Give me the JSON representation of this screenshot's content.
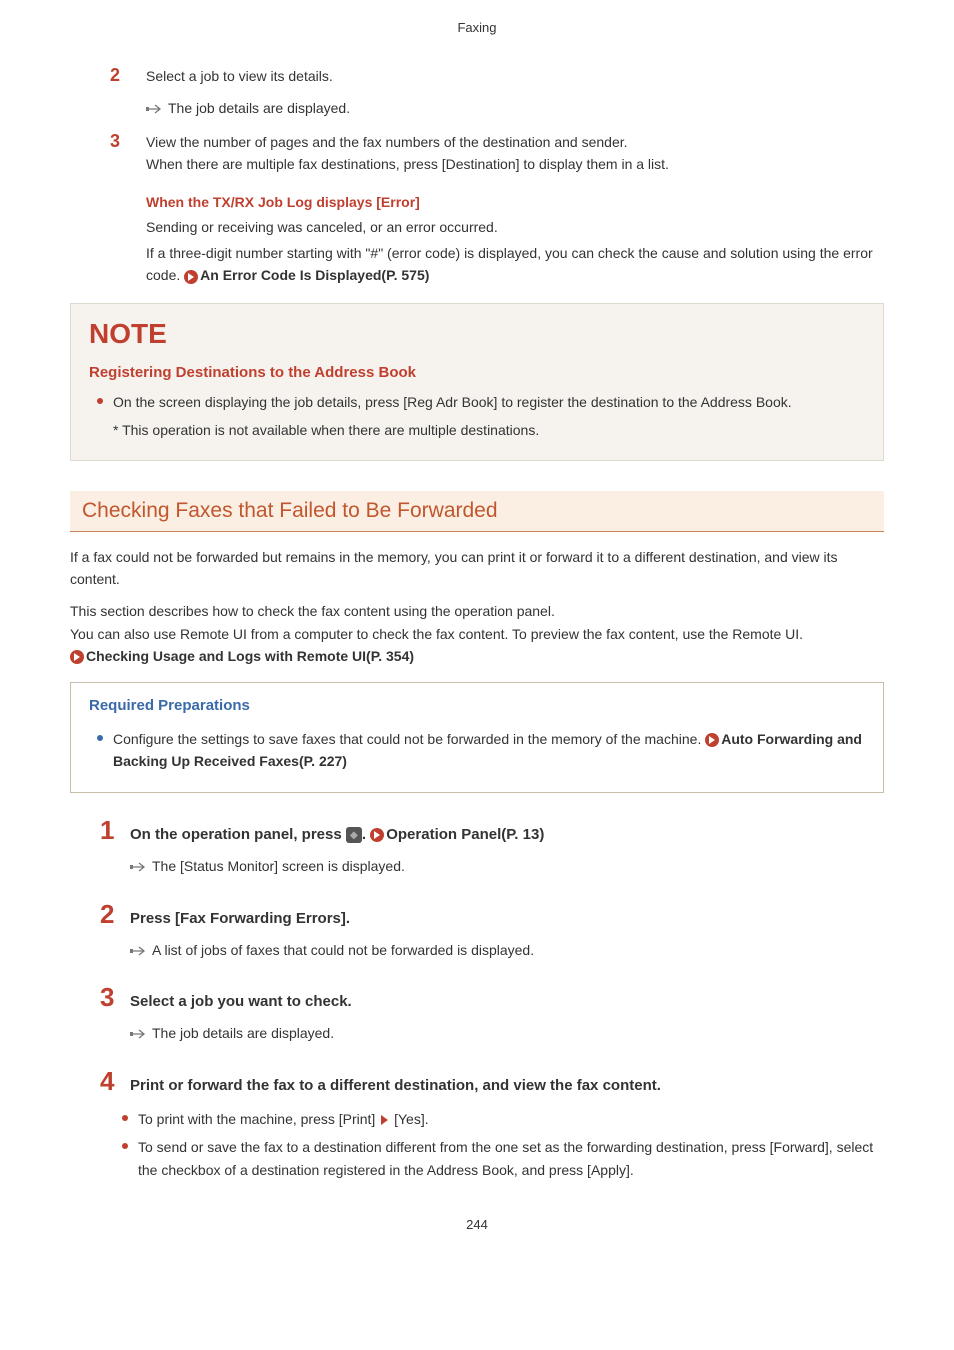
{
  "header": "Faxing",
  "topSteps": [
    {
      "num": "2",
      "text": "Select a job to view its details.",
      "result": "The job details are displayed."
    },
    {
      "num": "3",
      "line1": "View the number of pages and the fax numbers of the destination and sender.",
      "line2": "When there are multiple fax destinations, press [Destination] to display them in a list."
    }
  ],
  "errorSection": {
    "heading": "When the TX/RX Job Log displays [Error]",
    "line1": "Sending or receiving was canceled, or an error occurred.",
    "line2_a": "If a three-digit number starting with \"#\" (error code) is displayed, you can check the cause and solution using the error code. ",
    "ref": "An Error Code Is Displayed(P. 575)"
  },
  "note": {
    "title": "NOTE",
    "subtitle": "Registering Destinations to the Address Book",
    "bullet": "On the screen displaying the job details, press [Reg Adr Book] to register the destination to the Address Book.",
    "star": "* This operation is not available when there are multiple destinations."
  },
  "section": {
    "title": "Checking Faxes that Failed to Be Forwarded",
    "intro1": "If a fax could not be forwarded but remains in the memory, you can print it or forward it to a different destination, and view its content.",
    "intro2a": "This section describes how to check the fax content using the operation panel.",
    "intro2b": "You can also use Remote UI from a computer to check the fax content. To preview the fax content, use the Remote UI.",
    "ref2": "Checking Usage and Logs with Remote UI(P. 354)"
  },
  "prep": {
    "title": "Required Preparations",
    "bullet_a": "Configure the settings to save faxes that could not be forwarded in the memory of the machine. ",
    "bullet_ref": "Auto Forwarding and Backing Up Received Faxes(P. 227)"
  },
  "bigSteps": [
    {
      "num": "1",
      "head_a": "On the operation panel, press ",
      "head_b": ". ",
      "ref": "Operation Panel(P. 13)",
      "result": "The [Status Monitor] screen is displayed."
    },
    {
      "num": "2",
      "head": "Press [Fax Forwarding Errors].",
      "result": "A list of jobs of faxes that could not be forwarded is displayed."
    },
    {
      "num": "3",
      "head": "Select a job you want to check.",
      "result": "The job details are displayed."
    },
    {
      "num": "4",
      "head": "Print or forward the fax to a different destination, and view the fax content.",
      "bullets": [
        {
          "a": "To print with the machine, press [Print] ",
          "b": " [Yes]."
        },
        {
          "a": "To send or save the fax to a destination different from the one set as the forwarding destination, press [Forward], select the checkbox of a destination registered in the Address Book, and press [Apply]."
        }
      ]
    }
  ],
  "pageNumber": "244"
}
